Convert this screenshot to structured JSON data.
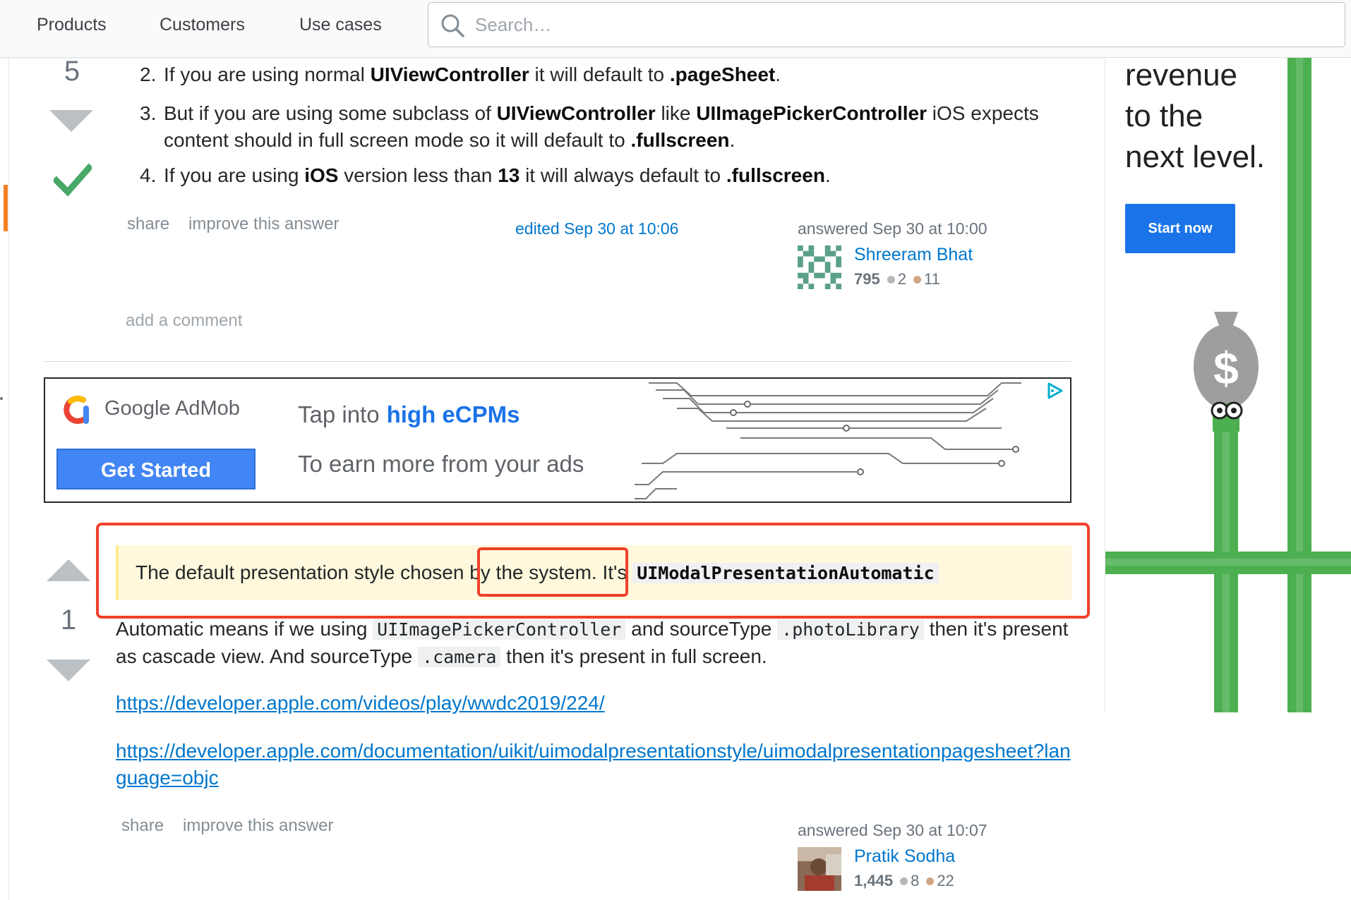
{
  "nav": {
    "items": [
      "Products",
      "Customers",
      "Use cases"
    ],
    "search_placeholder": "Search…"
  },
  "answer1": {
    "vote_count": "5",
    "accepted": true,
    "list_items": [
      {
        "num": "2.",
        "parts": [
          "If you are using normal ",
          "UIViewController",
          " it will default to ",
          ".pageSheet",
          "."
        ]
      },
      {
        "num": "3.",
        "parts": [
          "But if you are using some subclass of ",
          "UIViewController",
          " like ",
          "UIImagePickerController",
          " iOS expects content should in full screen mode so it will default to ",
          ".fullscreen",
          "."
        ]
      },
      {
        "num": "4.",
        "parts": [
          "If you are using ",
          "iOS",
          " version less than ",
          "13",
          " it will always default to ",
          ".fullscreen",
          "."
        ]
      }
    ],
    "actions": {
      "share": "share",
      "improve": "improve this answer"
    },
    "edited": "edited Sep 30 at 10:06",
    "answered": "answered Sep 30 at 10:00",
    "user": {
      "name": "Shreeram Bhat",
      "rep": "795",
      "silver": "2",
      "bronze": "11"
    },
    "add_comment": "add a comment"
  },
  "ad_banner": {
    "brand": "Google AdMob",
    "cta": "Get Started",
    "headline_prefix": "Tap into",
    "headline_highlight": "high eCPMs",
    "subline": "To earn more from your ads"
  },
  "answer2": {
    "vote_count": "1",
    "quote_prefix": "The default presentation style chose",
    "quote_mid": "n by the system.",
    "quote_suffix": " It's ",
    "quote_code": "UIModalPresentationAutomatic",
    "para_1": "Automatic means if we using",
    "code_1": "UIImagePickerController",
    "para_2": "and sourceType",
    "code_2": ".photoLibrary",
    "para_3": "then it's present as cascade view. And sourceType",
    "code_3": ".camera",
    "para_4": "then it's present in full screen.",
    "link_1": "https://developer.apple.com/videos/play/wwdc2019/224/",
    "link_2": "https://developer.apple.com/documentation/uikit/uimodalpresentationstyle/uimodalpresentationpagesheet?language=objc",
    "actions": {
      "share": "share",
      "improve": "improve this answer"
    },
    "answered": "answered Sep 30 at 10:07",
    "user": {
      "name": "Pratik Sodha",
      "rep": "1,445",
      "silver": "8",
      "bronze": "22"
    }
  },
  "side_ad": {
    "headline": [
      "revenue",
      "to the",
      "next level."
    ],
    "cta": "Start now"
  },
  "colors": {
    "accent_orange": "#f48024",
    "link_blue": "#0077cc",
    "highlight_red": "#f0402b",
    "accepted_green": "#48a868",
    "silver_badge": "#b4b8bc",
    "bronze_badge": "#d1a684"
  }
}
